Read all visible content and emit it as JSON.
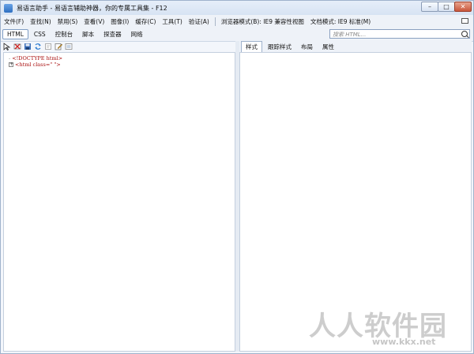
{
  "window": {
    "title": "易语言助手 - 易语言辅助神器，你的专属工具集 - F12"
  },
  "controls": {
    "minimize": "–",
    "maximize": "□",
    "close": "✕"
  },
  "menu": [
    "文件(F)",
    "查找(N)",
    "禁用(S)",
    "查看(V)",
    "图像(I)",
    "缓存(C)",
    "工具(T)",
    "验证(A)",
    "浏览器模式(B): IE9 兼容性视图",
    "文档模式: IE9 标准(M)"
  ],
  "tabs": [
    "HTML",
    "CSS",
    "控制台",
    "脚本",
    "探查器",
    "网络"
  ],
  "search": {
    "placeholder": "搜索 HTML..."
  },
  "right_tabs": [
    "样式",
    "跟踪样式",
    "布局",
    "属性"
  ],
  "tree": {
    "line1": "<!DOCTYPE html>",
    "line2": "<html class=\" \">",
    "expand_symbol": "+",
    "dash_symbol": "-"
  },
  "watermark": {
    "main": "人人软件园",
    "sub": "www.kkx.net"
  }
}
